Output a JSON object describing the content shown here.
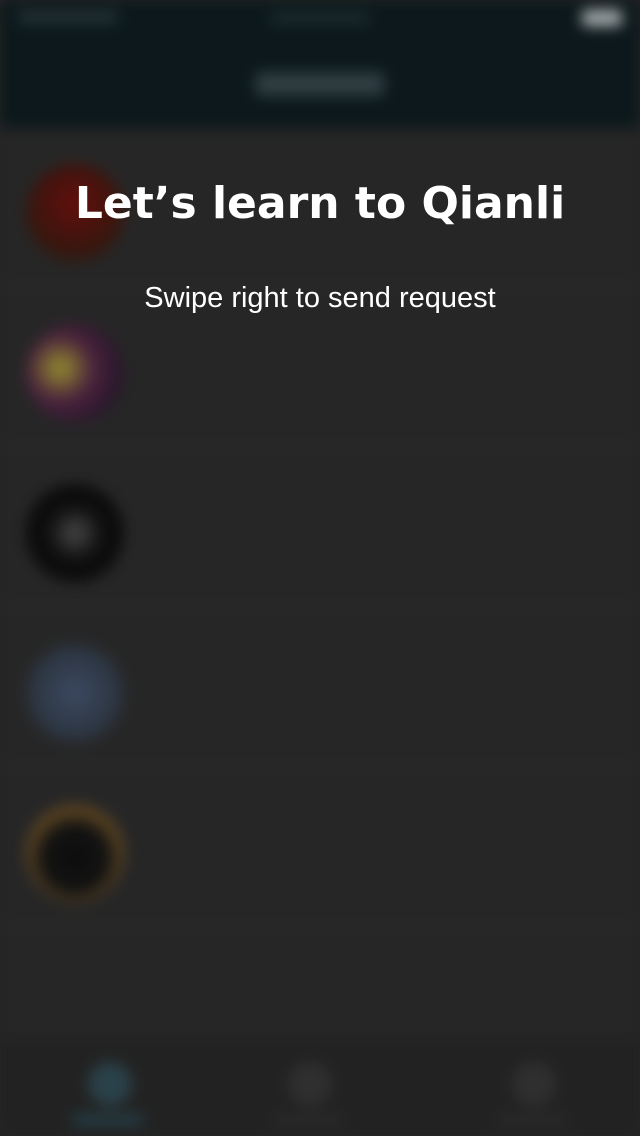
{
  "tutorial": {
    "title": "Let’s learn to Qianli",
    "subtitle": "Swipe right to send request"
  },
  "contacts": [
    {
      "name": "",
      "time": "",
      "preview": "",
      "avatar_icon": "heart-avatar"
    },
    {
      "name": "",
      "time": "",
      "preview": "",
      "avatar_icon": "colorful-avatar"
    },
    {
      "name": "",
      "time": "",
      "preview": "",
      "avatar_icon": "dark-avatar"
    },
    {
      "name": "",
      "time": "",
      "preview": "",
      "avatar_icon": "blue-avatar"
    },
    {
      "name": "",
      "time": "",
      "preview": "",
      "avatar_icon": "ring-avatar"
    }
  ],
  "colors": {
    "header_bg": "#0f1e22",
    "overlay_text": "#ffffff",
    "background": "#2f2f2f"
  }
}
